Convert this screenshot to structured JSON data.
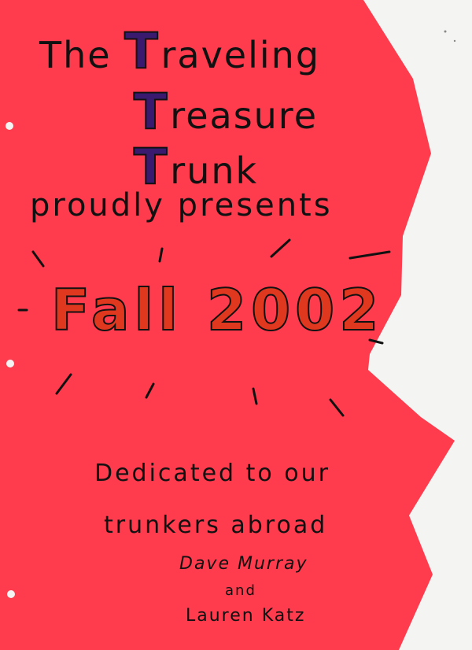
{
  "title": {
    "line1_prefix": "The ",
    "line1_cap": "T",
    "line1_rest": "raveling",
    "line2_cap": "T",
    "line2_rest": "reasure",
    "line3_cap": "T",
    "line3_rest": "runk"
  },
  "subtitle": "proudly presents",
  "season": "Fall 2002",
  "dedication": {
    "line1": "Dedicated to our",
    "line2": "trunkers abroad"
  },
  "names": {
    "first": "Dave Murray",
    "conjunction": "and",
    "second": "Lauren Katz"
  },
  "colors": {
    "paper": "#ff3b4e",
    "background": "#f4f4f2",
    "cap_fill": "#3a1a6e",
    "season_fill": "#e0381f",
    "ink": "#111111"
  }
}
